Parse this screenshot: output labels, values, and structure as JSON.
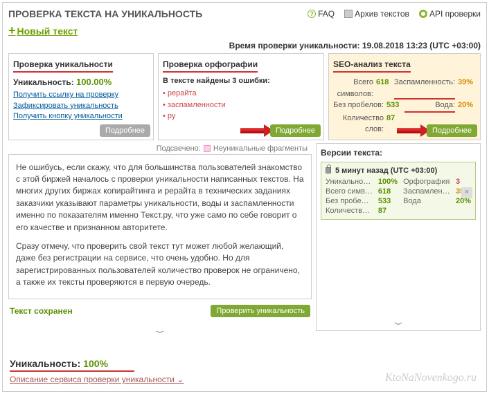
{
  "header": {
    "title": "ПРОВЕРКА ТЕКСТА НА УНИКАЛЬНОСТЬ",
    "faq": "FAQ",
    "archive": "Архив текстов",
    "api": "API проверки"
  },
  "newtext": "Новый текст",
  "checktime": "Время проверки уникальности: 19.08.2018 13:23 (UTC +03:00)",
  "cards": {
    "uniq": {
      "title": "Проверка уникальности",
      "label": "Уникальность:",
      "value": "100.00%",
      "link1": "Получить ссылку на проверку",
      "link2": "Зафиксировать уникальность",
      "link3": "Получить кнопку уникальности",
      "more": "Подробнее"
    },
    "spell": {
      "title": "Проверка орфографии",
      "subtitle": "В тексте найдены 3 ошибки:",
      "errors": [
        "рерайта",
        "заспамленности",
        "ру"
      ],
      "more": "Подробнее"
    },
    "seo": {
      "title": "SEO-анализ текста",
      "rows": [
        {
          "l1": "Всего символов:",
          "v1": "618",
          "l2": "Заспамленность:",
          "v2": "39%"
        },
        {
          "l1": "Без пробелов:",
          "v1": "533",
          "l2": "Вода:",
          "v2": "20%"
        },
        {
          "l1": "Количество слов:",
          "v1": "87",
          "l2": "",
          "v2": ""
        }
      ],
      "more": "Подробнее"
    }
  },
  "legend": {
    "label": "Подсвечено:",
    "text": "Неуникальные фрагменты"
  },
  "paragraphs": [
    "Не ошибусь, если скажу, что для большинства пользователей знакомство с этой биржей началось с проверки уникальности написанных текстов. На многих других биржах копирайтинга и рерайта в технических заданиях заказчики указывают параметры уникальности, воды и заспамленности именно по показателям именно Текст.ру, что уже само по себе говорит о его качестве и признанном авторитете.",
    "Сразу отмечу, что проверить свой текст тут может любой желающий, даже без регистрации на сервисе, что очень удобно. Но для зарегистрированных пользователей количество проверок не ограничено, а также их тексты проверяются в первую очередь."
  ],
  "saved": "Текст сохранен",
  "checkbtn": "Проверить уникальность",
  "versions": {
    "title": "Версии текста:",
    "item": {
      "title": "5 минут назад (UTC +03:00)",
      "rows": [
        {
          "k1": "Уникальность",
          "v1": "100%",
          "c1": "#5a9000",
          "k2": "Орфография",
          "v2": "3",
          "c2": "#c44"
        },
        {
          "k1": "Всего симво...",
          "v1": "618",
          "c1": "#5a9000",
          "k2": "Заспамленн...",
          "v2": "39%",
          "c2": "#d68a00"
        },
        {
          "k1": "Без пробелов",
          "v1": "533",
          "c1": "#5a9000",
          "k2": "Вода",
          "v2": "20%",
          "c2": "#5a9000"
        },
        {
          "k1": "Количество ...",
          "v1": "87",
          "c1": "#5a9000",
          "k2": "",
          "v2": "",
          "c2": ""
        }
      ]
    }
  },
  "footer": {
    "label": "Уникальность:",
    "value": "100%",
    "link": "Описание сервиса проверки уникальности"
  },
  "watermark": "KtoNaNovenkogo.ru"
}
